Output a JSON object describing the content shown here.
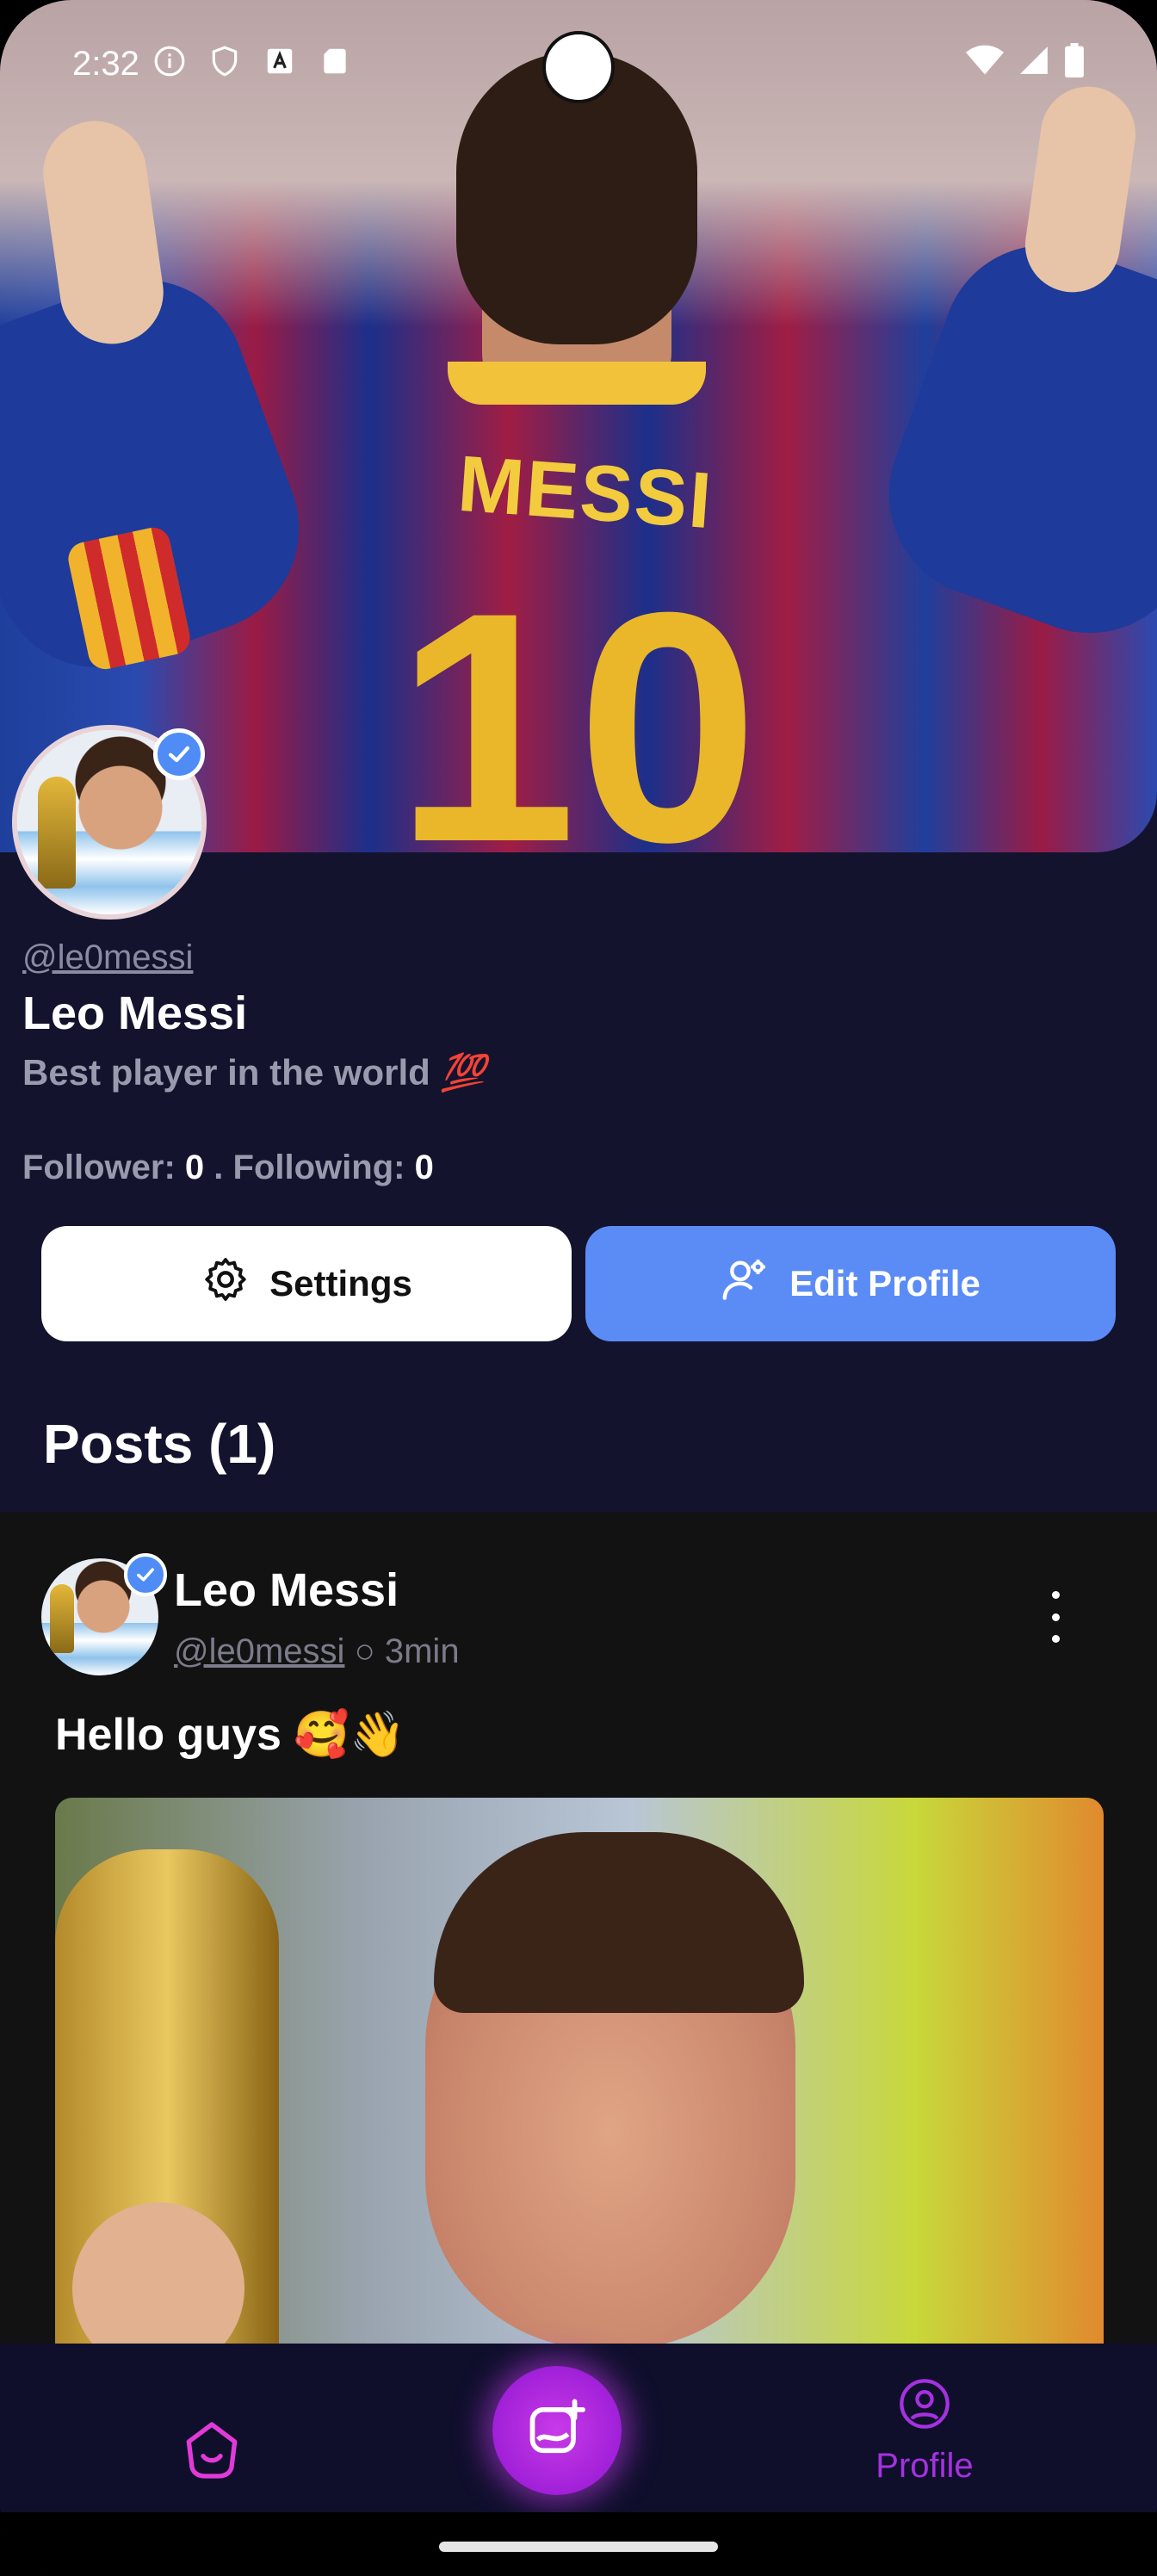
{
  "status_bar": {
    "time": "2:32"
  },
  "profile": {
    "handle": "@le0messi",
    "name": "Leo Messi",
    "bio": "Best player in the world",
    "bio_emoji": "💯",
    "follower_label": "Follower:",
    "follower_count": "0",
    "separator": ".",
    "following_label": "Following:",
    "following_count": "0"
  },
  "actions": {
    "settings_label": "Settings",
    "edit_profile_label": "Edit Profile"
  },
  "posts": {
    "title": "Posts (1)",
    "items": [
      {
        "author": "Leo Messi",
        "handle": "@le0messi",
        "dot": "○",
        "time": "3min",
        "text": "Hello guys 🥰👋"
      }
    ]
  },
  "cover_jersey": {
    "name": "MESSI",
    "number": "10"
  },
  "bottom_nav": {
    "profile_label": "Profile"
  },
  "colors": {
    "background": "#13132e",
    "accent_blue": "#5b8cf6",
    "accent_purple": "#a531e0",
    "fab_magenta": "#c83ae8"
  }
}
